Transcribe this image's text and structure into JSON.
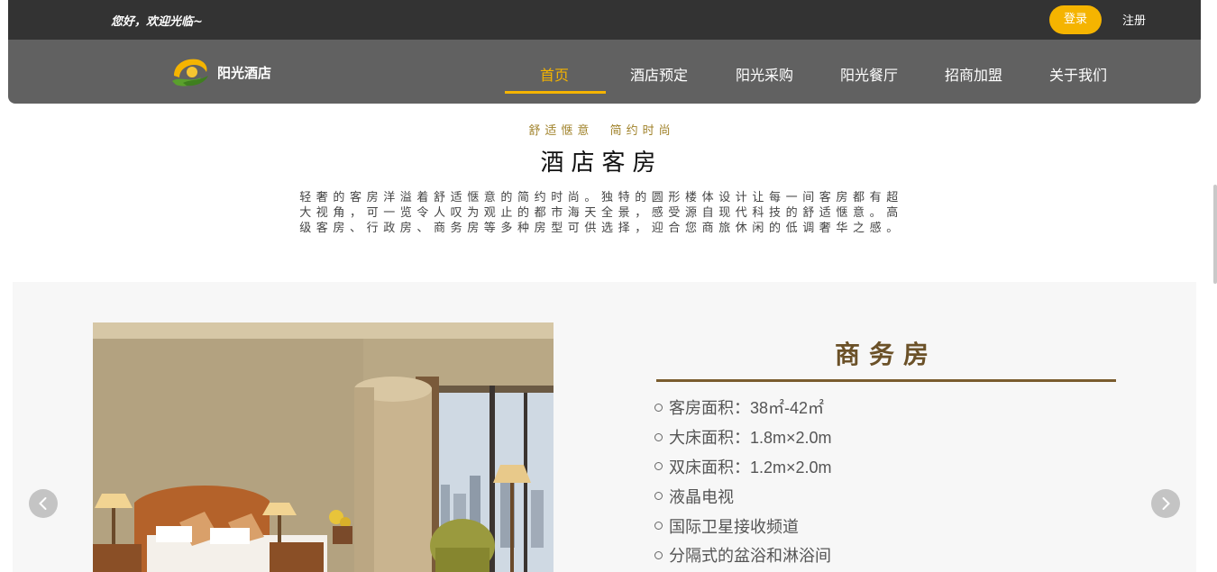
{
  "topbar": {
    "welcome": "您好，欢迎光临~",
    "login_label": "登录",
    "register_label": "注册"
  },
  "nav": {
    "logo_text": "阳光酒店",
    "items": [
      {
        "label": "首页",
        "active": true
      },
      {
        "label": "酒店预定"
      },
      {
        "label": "阳光采购"
      },
      {
        "label": "阳光餐厅"
      },
      {
        "label": "招商加盟"
      },
      {
        "label": "关于我们"
      }
    ]
  },
  "intro": {
    "subtitle": "舒适惬意  简约时尚",
    "title": "酒店客房",
    "description": "轻奢的客房洋溢着舒适惬意的简约时尚。独特的圆形楼体设计让每一间客房都有超大视角，可一览令人叹为观止的都市海天全景，感受源自现代科技的舒适惬意。高级客房、行政房、商务房等多种房型可供选择，迎合您商旅休闲的低调奢华之感。"
  },
  "room": {
    "name": "商务房",
    "features": [
      "客房面积：38㎡-42㎡",
      "大床面积：1.8m×2.0m",
      "双床面积：1.2m×2.0m",
      "液晶电视",
      "国际卫星接收频道",
      "分隔式的盆浴和淋浴间"
    ]
  },
  "colors": {
    "accent": "#f5b400",
    "topbar": "#333333",
    "navbar": "#616161",
    "room_title": "#6b5128"
  },
  "icons": {
    "logo": "hotel-logo-icon",
    "prev": "chevron-left-icon",
    "next": "chevron-right-icon",
    "bullet": "circle-bullet-icon"
  }
}
